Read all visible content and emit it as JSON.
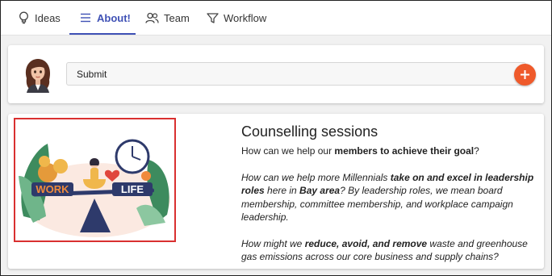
{
  "tabs": [
    {
      "label": "Ideas",
      "icon": "lightbulb-icon",
      "active": false
    },
    {
      "label": "About!",
      "icon": "menu-icon",
      "active": true
    },
    {
      "label": "Team",
      "icon": "people-icon",
      "active": false
    },
    {
      "label": "Workflow",
      "icon": "filter-icon",
      "active": false
    }
  ],
  "composer": {
    "avatar_icon": "avatar",
    "input_value": "Submit",
    "add_icon": "plus-icon",
    "add_color": "#ef5a2b"
  },
  "content": {
    "image_word_left": "WORK",
    "image_word_right": "LIFE",
    "title": "Counselling sessions",
    "intro": {
      "pre": "How can we help our ",
      "bold": "members to achieve their goal",
      "post": "?"
    },
    "para1": {
      "a": "How can we help more Millennials ",
      "b": "take on and excel in leadership roles",
      "c": " here in ",
      "d": "Bay area",
      "e": "? By leadership roles, we mean board membership, committee membership, and workplace campaign leadership."
    },
    "para2": {
      "a": "How might we ",
      "b": "reduce, avoid, and remove",
      "c": " waste and greenhouse gas emissions across our core business and supply chains?"
    }
  },
  "colors": {
    "accent": "#3f51b5",
    "highlight_border": "#d93030"
  }
}
